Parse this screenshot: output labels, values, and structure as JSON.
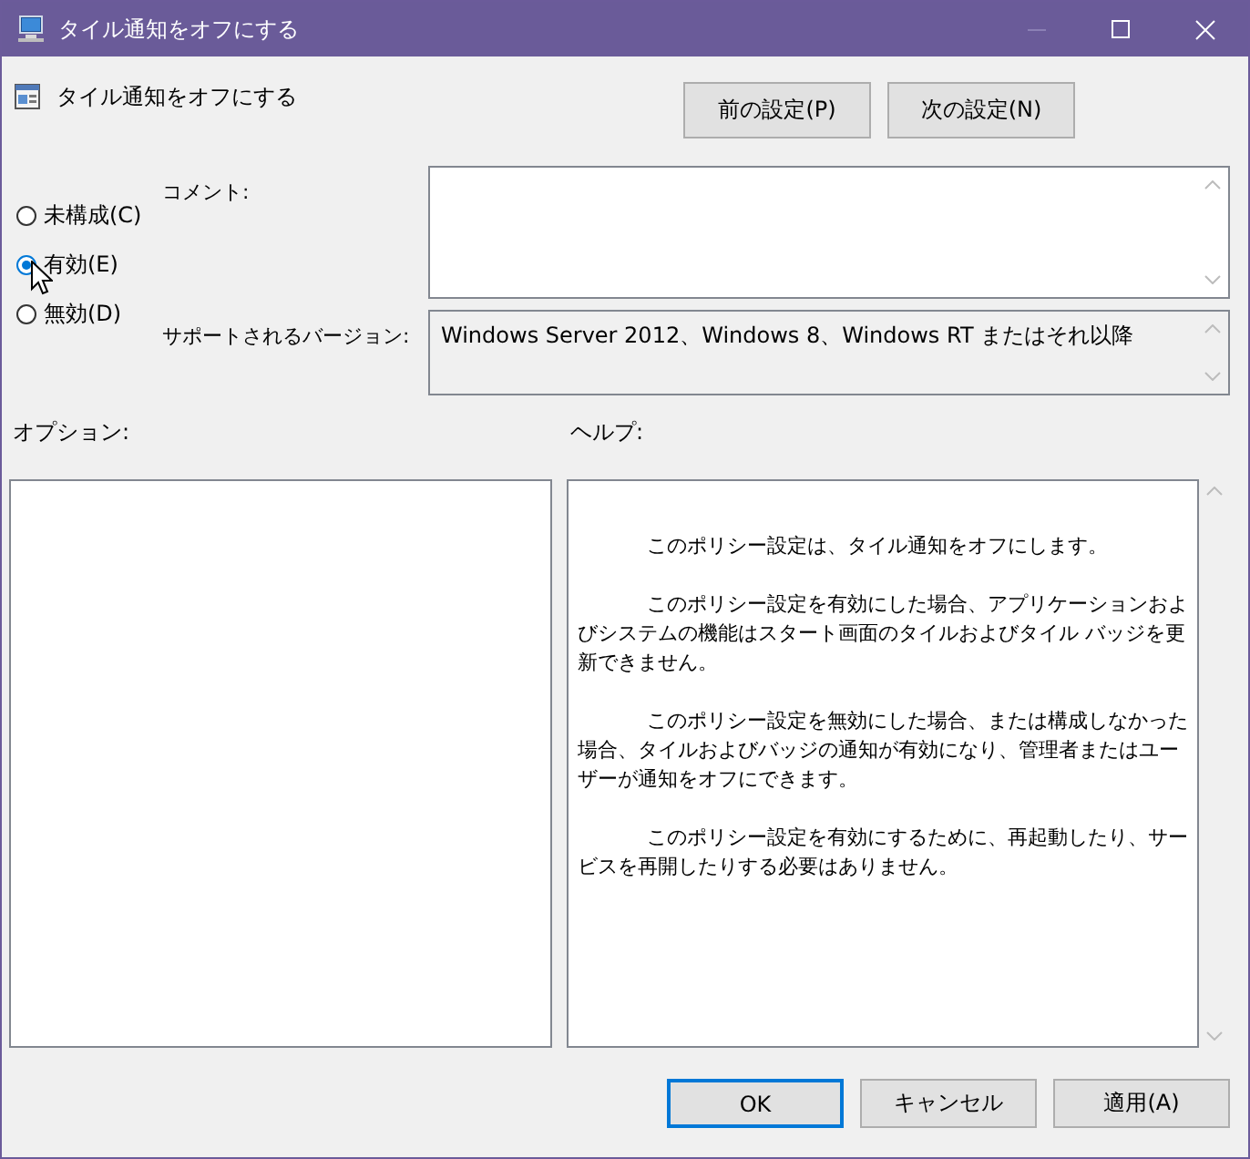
{
  "window": {
    "title": "タイル通知をオフにする"
  },
  "policy": {
    "title": "タイル通知をオフにする"
  },
  "nav_buttons": [
    "前の設定(P)",
    "次の設定(N)"
  ],
  "radios": [
    {
      "label": "未構成(C)",
      "selected": false
    },
    {
      "label": "有効(E)",
      "selected": true
    },
    {
      "label": "無効(D)",
      "selected": false
    }
  ],
  "comment": {
    "label": "コメント:"
  },
  "supported": {
    "label": "サポートされるバージョン:",
    "value": "Windows Server 2012、Windows 8、Windows RT またはそれ以降"
  },
  "options": {
    "label": "オプション:"
  },
  "help": {
    "label": "ヘルプ:",
    "paragraphs": [
      "このポリシー設定は、タイル通知をオフにします。",
      "このポリシー設定を有効にした場合、アプリケーションおよびシステムの機能はスタート画面のタイルおよびタイル バッジを更新できません。",
      "このポリシー設定を無効にした場合、または構成しなかった場合、タイルおよびバッジの通知が有効になり、管理者またはユーザーが通知をオフにできます。",
      "このポリシー設定を有効にするために、再起動したり、サービスを再開したりする必要はありません。"
    ]
  },
  "buttons": [
    {
      "label": "OK",
      "default": true
    },
    {
      "label": "キャンセル",
      "default": false
    },
    {
      "label": "適用(A)",
      "default": false
    }
  ]
}
